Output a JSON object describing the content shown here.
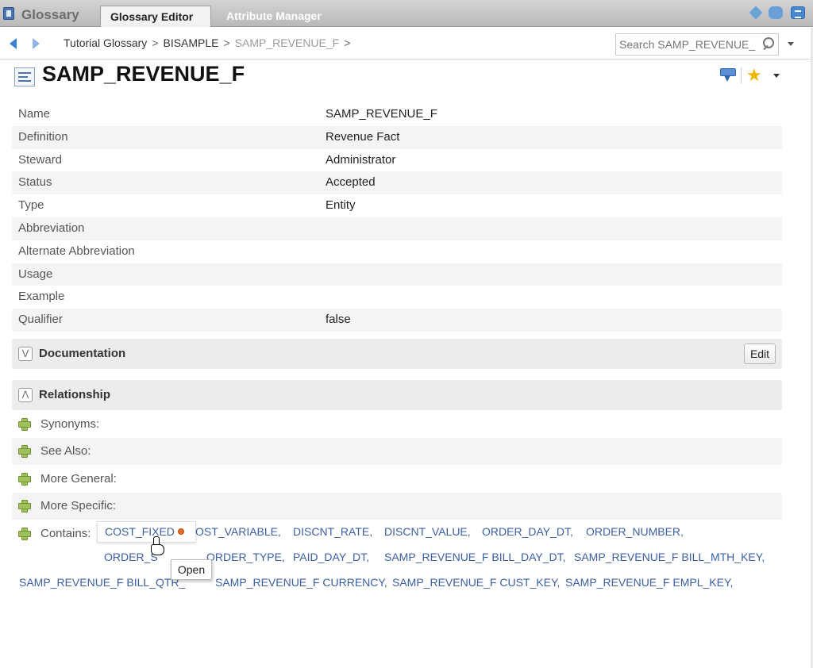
{
  "app": {
    "title": "Glossary",
    "tabs": [
      {
        "label": "Glossary Editor",
        "active": true
      },
      {
        "label": "Attribute Manager",
        "active": false
      }
    ],
    "top_icons": [
      "tag-icon",
      "comments-icon",
      "menu-icon"
    ]
  },
  "breadcrumb": {
    "items": [
      "Tutorial Glossary",
      "BISAMPLE",
      "SAMP_REVENUE_F"
    ],
    "separator": ">",
    "trailing": ">"
  },
  "search": {
    "placeholder": "Search SAMP_REVENUE_F"
  },
  "page": {
    "title": "SAMP_REVENUE_F"
  },
  "properties": [
    {
      "label": "Name",
      "value": "SAMP_REVENUE_F"
    },
    {
      "label": "Definition",
      "value": "Revenue Fact"
    },
    {
      "label": "Steward",
      "value": "Administrator"
    },
    {
      "label": "Status",
      "value": "Accepted"
    },
    {
      "label": "Type",
      "value": "Entity"
    },
    {
      "label": "Abbreviation",
      "value": ""
    },
    {
      "label": "Alternate Abbreviation",
      "value": ""
    },
    {
      "label": "Usage",
      "value": ""
    },
    {
      "label": "Example",
      "value": ""
    },
    {
      "label": "Qualifier",
      "value": "false"
    }
  ],
  "documentation": {
    "title": "Documentation",
    "edit_label": "Edit"
  },
  "relationship": {
    "title": "Relationship",
    "rows": [
      {
        "label": "Synonyms:"
      },
      {
        "label": "See Also:"
      },
      {
        "label": "More General:"
      },
      {
        "label": "More Specific:"
      }
    ],
    "contains": {
      "label": "Contains:",
      "items": [
        "COST_FIXED",
        "OST_VARIABLE,",
        "DISCNT_RATE,",
        "DISCNT_VALUE,",
        "ORDER_DAY_DT,",
        "ORDER_NUMBER,",
        "ORDER_S",
        "ORDER_TYPE,",
        "PAID_DAY_DT,",
        "SAMP_REVENUE_F BILL_DAY_DT,",
        "SAMP_REVENUE_F BILL_MTH_KEY,",
        "SAMP_REVENUE_F BILL_QTR_",
        "SAMP_REVENUE_F CURRENCY,",
        "SAMP_REVENUE_F CUST_KEY,",
        "SAMP_REVENUE_F EMPL_KEY,"
      ],
      "popup_label": "Open"
    }
  },
  "colors": {
    "link": "#3a5fa5",
    "accent": "#3d7fd1",
    "star": "#f0b400",
    "status_dot": "#e56b1f"
  }
}
